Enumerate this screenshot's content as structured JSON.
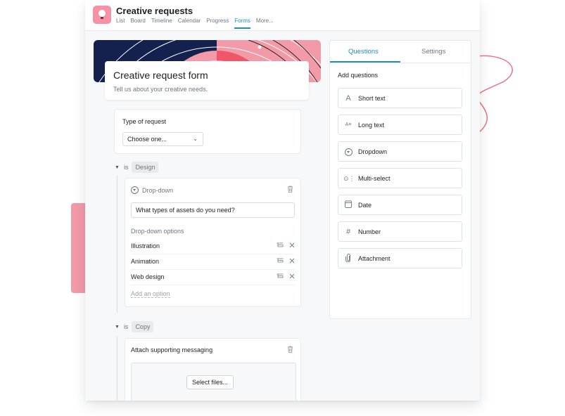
{
  "project": {
    "title": "Creative requests",
    "icon": "lightbulb-icon",
    "nav": [
      {
        "label": "List",
        "active": false
      },
      {
        "label": "Board",
        "active": false
      },
      {
        "label": "Timeline",
        "active": false
      },
      {
        "label": "Calendar",
        "active": false
      },
      {
        "label": "Progress",
        "active": false
      },
      {
        "label": "Forms",
        "active": true
      },
      {
        "label": "More...",
        "active": false
      }
    ]
  },
  "form": {
    "title": "Creative request form",
    "description": "Tell us about your creative needs.",
    "type_question": {
      "label": "Type of request",
      "select_value": "Choose one..."
    },
    "branches": [
      {
        "condition_prefix": "is",
        "condition_value": "Design",
        "question": {
          "type_label": "Drop-down",
          "text": "What types of assets do you need?",
          "options_label": "Drop-down options",
          "options": [
            "Illustration",
            "Animation",
            "Web design"
          ],
          "add_option_label": "Add an option"
        }
      },
      {
        "condition_prefix": "is",
        "condition_value": "Copy",
        "question": {
          "text": "Attach supporting messaging",
          "button_label": "Select files..."
        }
      }
    ]
  },
  "panel": {
    "tabs": [
      {
        "label": "Questions",
        "active": true
      },
      {
        "label": "Settings",
        "active": false
      }
    ],
    "heading": "Add questions",
    "question_types": [
      {
        "label": "Short text",
        "icon": "text-a-icon"
      },
      {
        "label": "Long text",
        "icon": "long-text-icon"
      },
      {
        "label": "Dropdown",
        "icon": "dropdown-circle-icon"
      },
      {
        "label": "Multi-select",
        "icon": "multi-select-icon"
      },
      {
        "label": "Date",
        "icon": "calendar-icon"
      },
      {
        "label": "Number",
        "icon": "hash-icon"
      },
      {
        "label": "Attachment",
        "icon": "paperclip-icon"
      }
    ]
  },
  "colors": {
    "accent": "#1f8eb8",
    "brand_pink": "#f592a6",
    "banner_navy": "#14204e",
    "banner_coral": "#f0566a"
  }
}
